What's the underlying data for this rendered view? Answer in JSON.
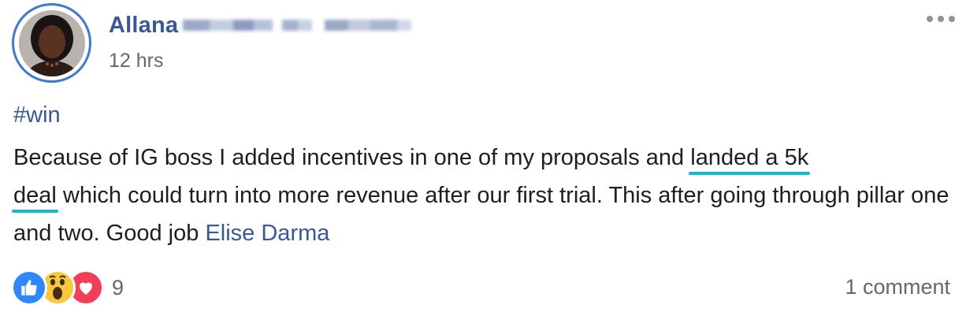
{
  "post": {
    "author_name": "Allana",
    "timestamp": "12 hrs",
    "hashtag": "#win",
    "text_part1": "Because of IG boss I added incentives in one of my proposals and ",
    "highlight_line1": "landed a 5k",
    "highlight_line2": "deal",
    "text_part2": " which could turn into more revenue after our first trial. This after going through pillar one and two. Good job ",
    "mention": "Elise Darma"
  },
  "footer": {
    "reaction_count": "9",
    "comments": "1 comment"
  },
  "colors": {
    "link": "#385898",
    "highlight_underline": "#17b8c7",
    "like": "#2d88ff",
    "wow": "#f7c83c",
    "love": "#f33e58"
  },
  "icons": [
    "more-options-icon",
    "like-reaction-icon",
    "wow-reaction-icon",
    "love-reaction-icon"
  ]
}
